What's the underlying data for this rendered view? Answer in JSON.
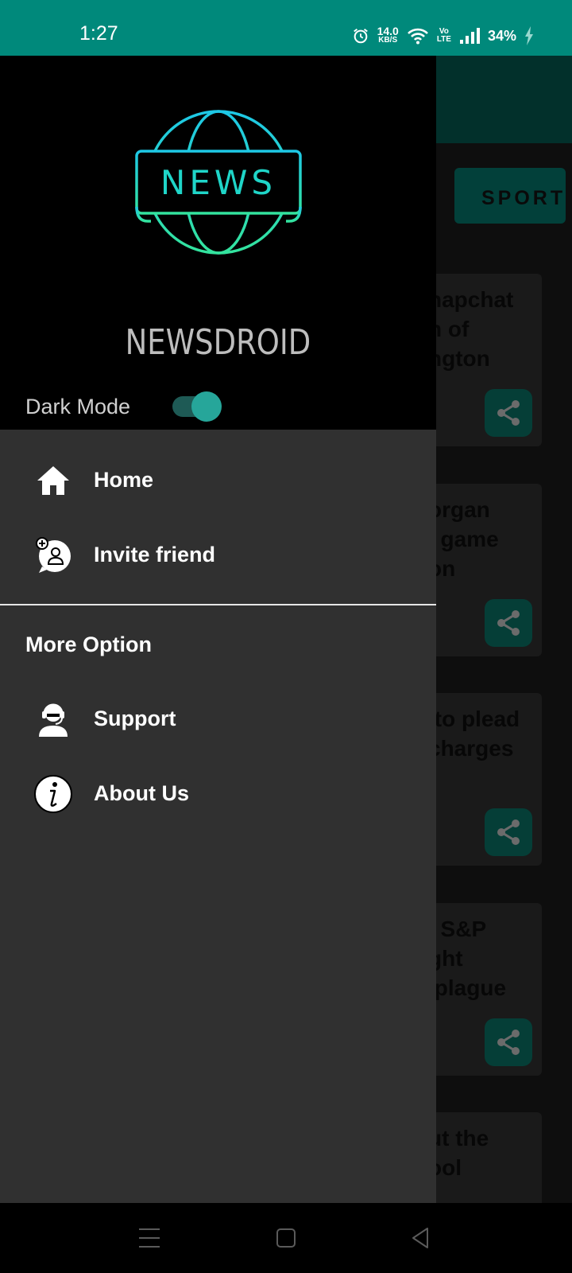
{
  "status_bar": {
    "time": "1:27",
    "net_speed_value": "14.0",
    "net_speed_unit": "KB/S",
    "volte_top": "Vo",
    "volte_bottom": "LTE",
    "battery": "34%",
    "icons": [
      "alarm-icon",
      "wifi-icon",
      "volte-icon",
      "signal-icon",
      "charging-icon"
    ]
  },
  "drawer": {
    "logo_text": "NEWS",
    "app_title": "NEWSDROID",
    "dark_mode_label": "Dark Mode",
    "dark_mode_on": true,
    "items": [
      {
        "label": "Home",
        "icon": "home-icon"
      },
      {
        "label": "Invite friend",
        "icon": "invite-friend-icon"
      }
    ],
    "section_title": "More Option",
    "more_items": [
      {
        "label": "Support",
        "icon": "support-icon"
      },
      {
        "label": "About Us",
        "icon": "info-icon"
      }
    ]
  },
  "background": {
    "category_chip": "SPORT",
    "cards": [
      "napchat\nn of\nngton",
      "organ\nl game\non",
      " to plead\ncharges\nl",
      ", S&P\nght\n plague",
      "ut the\nool"
    ]
  },
  "nav_bar": {
    "buttons": [
      "menu-icon",
      "home-square-icon",
      "back-triangle-icon"
    ]
  },
  "colors": {
    "status_bar": "#00897b",
    "accent": "#26a69a",
    "drawer_bg": "#303030",
    "header_bg": "#000000"
  }
}
